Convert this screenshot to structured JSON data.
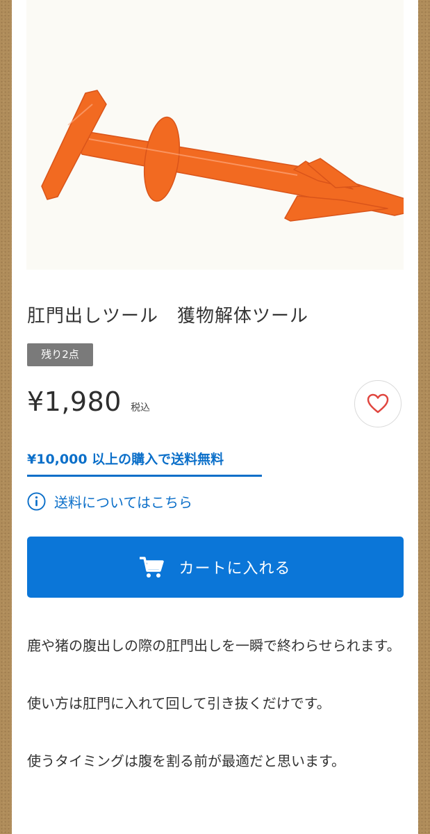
{
  "product": {
    "title": "肛門出しツール　獲物解体ツール",
    "stock_badge": "残り2点",
    "price": "¥1,980",
    "tax_label": "税込",
    "free_shipping": "¥10,000 以上の購入で送料無料",
    "shipping_info": "送料についてはこちら",
    "cart_button": "カートに入れる",
    "description": [
      "鹿や猪の腹出しの際の肛門出しを一瞬で終わらせられます。",
      "使い方は肛門に入れて回して引き抜くだけです。",
      "使うタイミングは腹を割る前が最適だと思います。"
    ]
  },
  "colors": {
    "accent": "#0b76d8",
    "link": "#0b6fc9",
    "product": "#f26a21",
    "heart": "#e0463f"
  },
  "icons": {
    "favorite": "heart-icon",
    "info": "info-icon",
    "cart": "cart-icon"
  }
}
